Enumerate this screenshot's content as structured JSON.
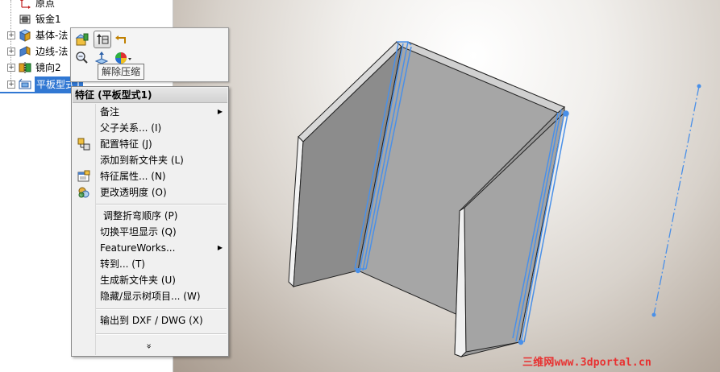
{
  "tree": {
    "items": [
      {
        "label": "原点"
      },
      {
        "label": "钣金1"
      },
      {
        "label": "基体-法"
      },
      {
        "label": "边线-法"
      },
      {
        "label": "镜向2"
      },
      {
        "label": "平板型式1"
      }
    ]
  },
  "toolbar": {
    "tooltip": "解除压缩",
    "icons": [
      "edit-feature-icon",
      "unsuppress-icon",
      "rollback-icon",
      "zoom-to-selection-icon",
      "normal-to-icon",
      "appearance-icon"
    ]
  },
  "menu": {
    "header": "特征 (平板型式1)",
    "items": [
      {
        "label": "备注",
        "submenu": true
      },
      {
        "label": "父子关系... (I)"
      },
      {
        "label": "配置特征 (J)"
      },
      {
        "label": "添加到新文件夹 (L)"
      },
      {
        "label": "特征属性... (N)"
      },
      {
        "label": "更改透明度 (O)"
      },
      {
        "label": "调整折弯顺序 (P)"
      },
      {
        "label": "切换平坦显示 (Q)"
      },
      {
        "label": "FeatureWorks...",
        "submenu": true
      },
      {
        "label": "转到... (T)"
      },
      {
        "label": "生成新文件夹 (U)"
      },
      {
        "label": "隐藏/显示树项目... (W)"
      },
      {
        "label": "输出到 DXF / DWG (X)"
      }
    ],
    "more": "»"
  },
  "watermark": "三维网www.3dportal.cn",
  "colors": {
    "selection": "#3178d3",
    "highlight_edge": "#4a90e8",
    "watermark": "#e83030"
  }
}
